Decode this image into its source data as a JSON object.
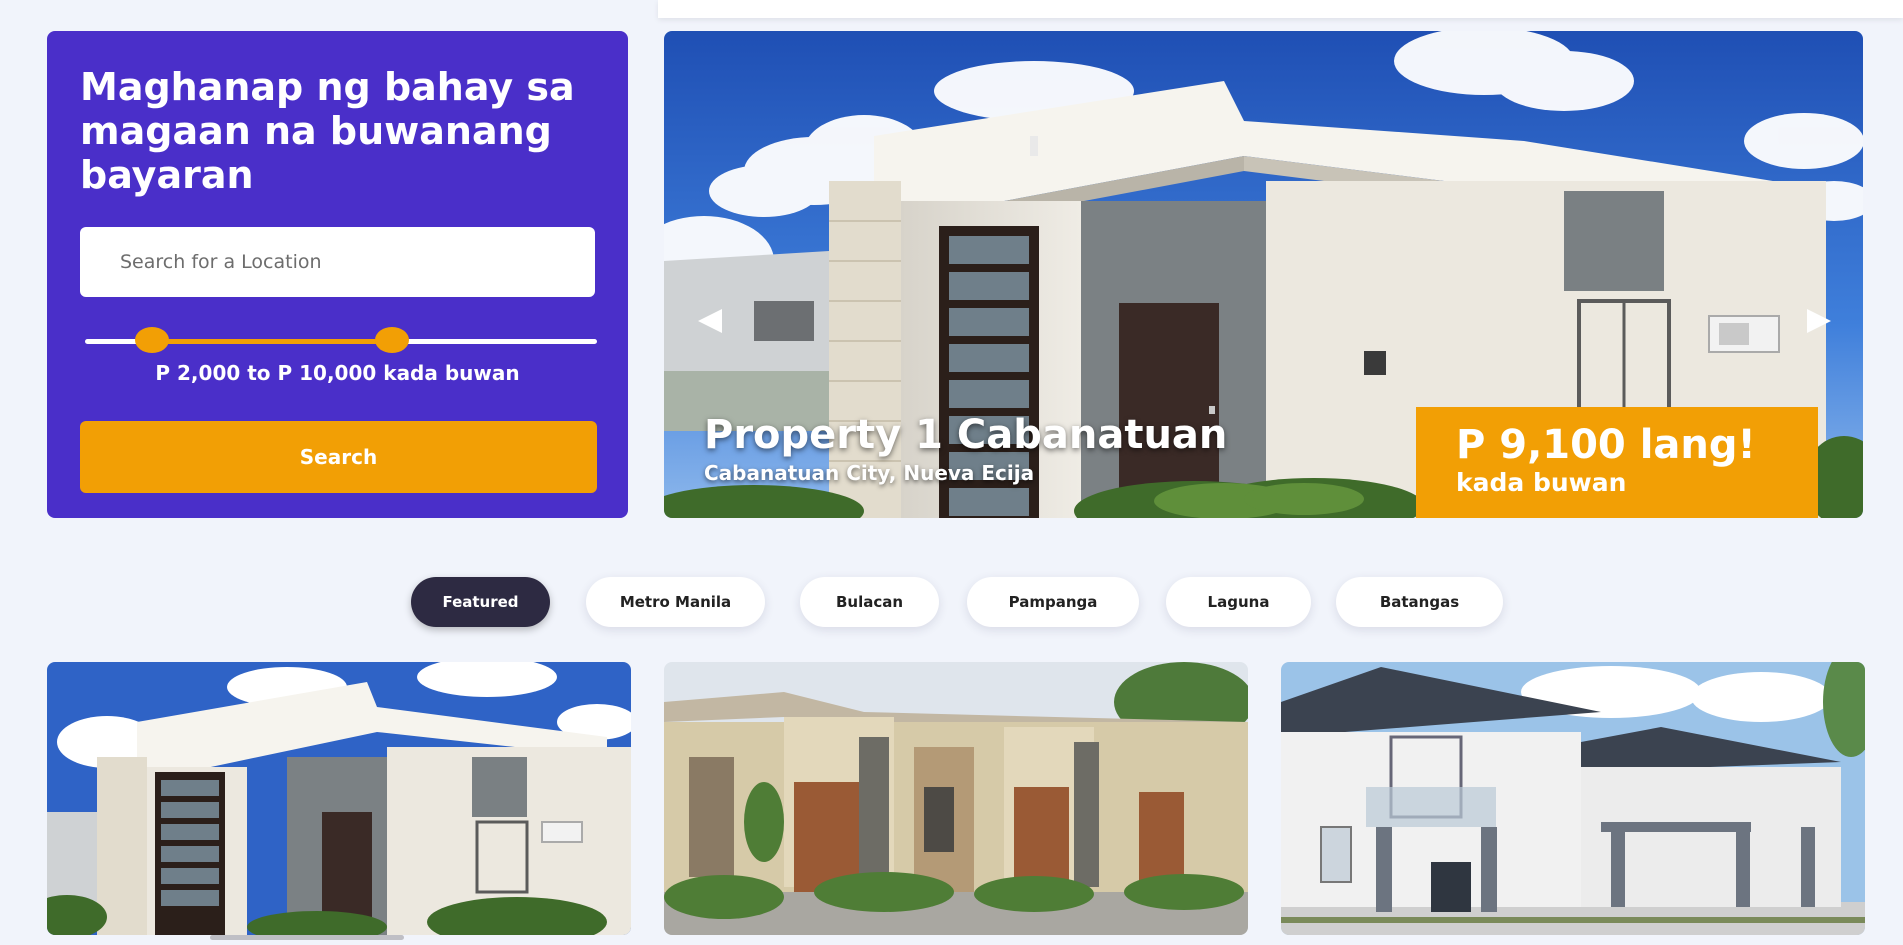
{
  "search_panel": {
    "title": "Maghanap ng bahay sa magaan na buwanang bayaran",
    "search_placeholder": "Search for a Location",
    "price_range": {
      "min_value": 2000,
      "max_value": 10000,
      "label": "P 2,000 to P 10,000 kada buwan",
      "handle_low_fraction": 0.13,
      "handle_high_fraction": 0.6
    },
    "search_button_label": "Search"
  },
  "hero": {
    "title": "Property 1 Cabanatuan",
    "location": "Cabanatuan City, Nueva Ecija",
    "price": "P 9,100 lang!",
    "price_unit": "kada buwan",
    "prev_icon": "caret-left-icon",
    "next_icon": "caret-right-icon"
  },
  "tabs": [
    {
      "label": "Featured",
      "active": true
    },
    {
      "label": "Metro Manila",
      "active": false
    },
    {
      "label": "Bulacan",
      "active": false
    },
    {
      "label": "Pampanga",
      "active": false
    },
    {
      "label": "Laguna",
      "active": false
    },
    {
      "label": "Batangas",
      "active": false
    }
  ],
  "colors": {
    "page_background": "#f1f4fb",
    "panel_purple": "#4a2fc9",
    "accent_orange": "#f29f05",
    "active_tab": "#2d2a42"
  }
}
